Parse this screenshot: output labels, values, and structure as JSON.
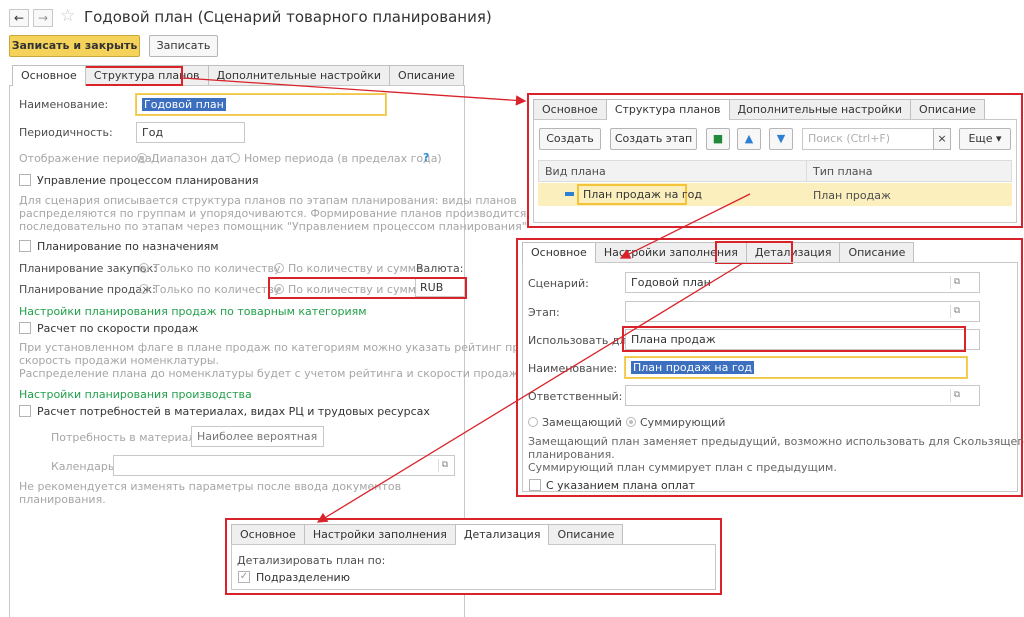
{
  "window": {
    "title": "Годовой план (Сценарий товарного планирования)",
    "back": "←",
    "forward": "→",
    "star": "☆"
  },
  "toolbar": {
    "save_close": "Записать и закрыть",
    "save": "Записать"
  },
  "tabs": [
    "Основное",
    "Структура планов",
    "Дополнительные настройки",
    "Описание"
  ],
  "form": {
    "name_label": "Наименование:",
    "name_value": "Годовой план",
    "period_label": "Периодичность:",
    "period_value": "Год",
    "display_label": "Отображение периода:",
    "display_opt1": "Диапазон дат",
    "display_opt2": "Номер периода (в пределах года)",
    "help": "?",
    "process_label": "Управление процессом планирования",
    "process_note": [
      "Для сценария описывается структура планов по этапам планирования: виды планов",
      "распределяются по группам и упорядочиваются. Формирование планов производится",
      "последовательно по этапам через помощник \"Управлением процессом планирования\""
    ],
    "assign_label": "Планирование по назначениям",
    "purchase_label": "Планирование закупок:",
    "purchase_opt1": "Только по количеству",
    "purchase_opt2": "По количеству и сумме",
    "currency_label": "Валюта:",
    "sales_label": "Планирование продаж:",
    "sales_opt1": "Только по количеству",
    "sales_opt2": "По количеству и сумме",
    "currency_value": "RUB",
    "cat_header": "Настройки планирования продаж по товарным категориям",
    "speed_label": "Расчет по скорости продаж",
    "speed_note": [
      "При установленном флаге в плане продаж по категориям можно указать рейтинг продаж и",
      "скорость продажи номенклатуры.",
      "Распределение плана до номенклатуры будет с учетом рейтинга и скорости продажи."
    ],
    "prod_header": "Настройки планирования производства",
    "needs_label": "Расчет потребностей в материалах, видах РЦ и трудовых ресурсах",
    "mat_label": "Потребность в материалах:",
    "mat_value": "Наиболее вероятная",
    "cal_label": "Календарь:",
    "cal_value": "",
    "final_note": [
      "Не рекомендуется изменять параметры после ввода документов",
      "планирования."
    ]
  },
  "panel1": {
    "tabs": [
      "Основное",
      "Структура планов",
      "Дополнительные настройки",
      "Описание"
    ],
    "create": "Создать",
    "create_stage": "Создать этап",
    "search_placeholder": "Поиск (Ctrl+F)",
    "clear": "×",
    "more": "Еще ▾",
    "col1": "Вид плана",
    "col2": "Тип плана",
    "row_kind": "План продаж на год",
    "row_type": "План продаж"
  },
  "panel2": {
    "tabs": [
      "Основное",
      "Настройки заполнения",
      "Детализация",
      "Описание"
    ],
    "scenario_label": "Сценарий:",
    "scenario_value": "Годовой план",
    "stage_label": "Этап:",
    "stage_value": "",
    "use_label": "Использовать для:",
    "use_value": "Плана продаж",
    "name_label": "Наименование:",
    "name_value": "План продаж на год",
    "resp_label": "Ответственный:",
    "resp_value": "",
    "mode_opt1": "Замещающий",
    "mode_opt2": "Суммирующий",
    "note": [
      "Замещающий план заменяет предыдущий, возможно использовать для Скользящего",
      "планирования.",
      "Суммирующий план суммирует план с предыдущим."
    ],
    "payments_label": "С указанием плана оплат"
  },
  "panel3": {
    "tabs": [
      "Основное",
      "Настройки заполнения",
      "Детализация",
      "Описание"
    ],
    "header": "Детализировать план по:",
    "dept_label": "Подразделению",
    "check": "✓"
  },
  "icons": {
    "open": "⧉"
  },
  "colors": {
    "accent": "#f5d35a",
    "red": "#d9222a",
    "green": "#21a04a",
    "selection": "#3c6fbf"
  }
}
